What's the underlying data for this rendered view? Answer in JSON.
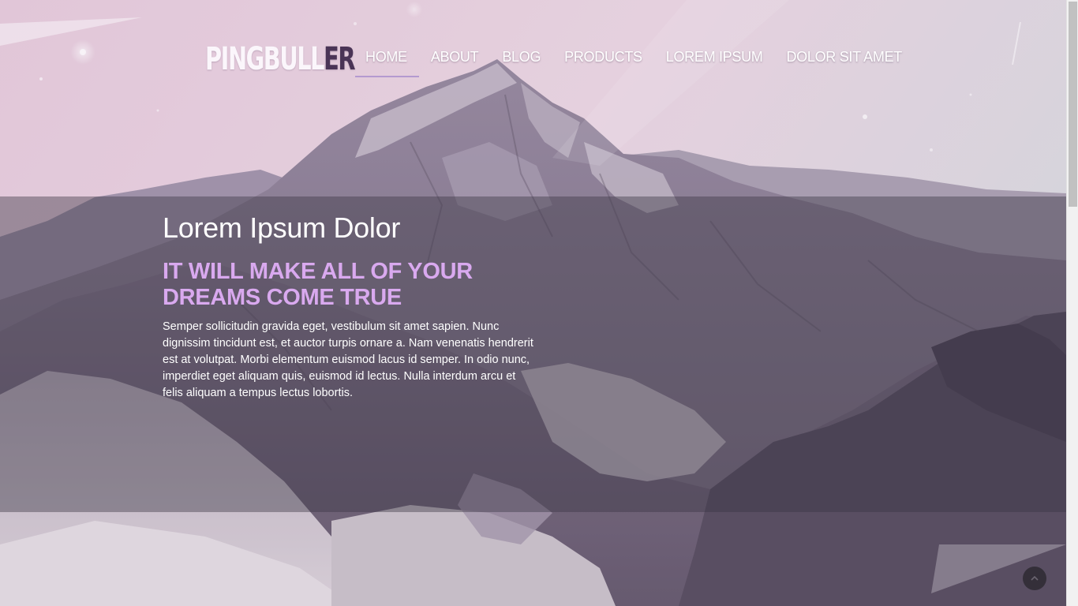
{
  "logo": {
    "main": "PINGBULL",
    "accent": "ER"
  },
  "nav": {
    "items": [
      {
        "label": "HOME",
        "active": true
      },
      {
        "label": "ABOUT",
        "active": false
      },
      {
        "label": "BLOG",
        "active": false
      },
      {
        "label": "PRODUCTS",
        "active": false
      },
      {
        "label": "LOREM IPSUM",
        "active": false
      },
      {
        "label": "DOLOR SIT AMET",
        "active": false
      }
    ]
  },
  "hero": {
    "title": "Lorem Ipsum Dolor",
    "subtitle": "IT WILL MAKE ALL OF YOUR DREAMS COME TRUE",
    "body": "Semper sollicitudin gravida eget, vestibulum sit amet sapien. Nunc dignissim tincidunt est, et auctor turpis ornare a. Nam venenatis hendrerit est at volutpat. Morbi elementum euismod lacus id semper. In odio nunc, imperdiet eget aliquam quis, euismod id lectus. Nulla interdum arcu et felis aliquam a tempus lectus lobortis."
  },
  "icons": {
    "to_top": "chevron-up-icon"
  },
  "colors": {
    "subtitle": "#d9a9ef",
    "nav_underline": "#b49ad0",
    "logo_accent": "#4a3456",
    "sky": "#e8d3df"
  }
}
